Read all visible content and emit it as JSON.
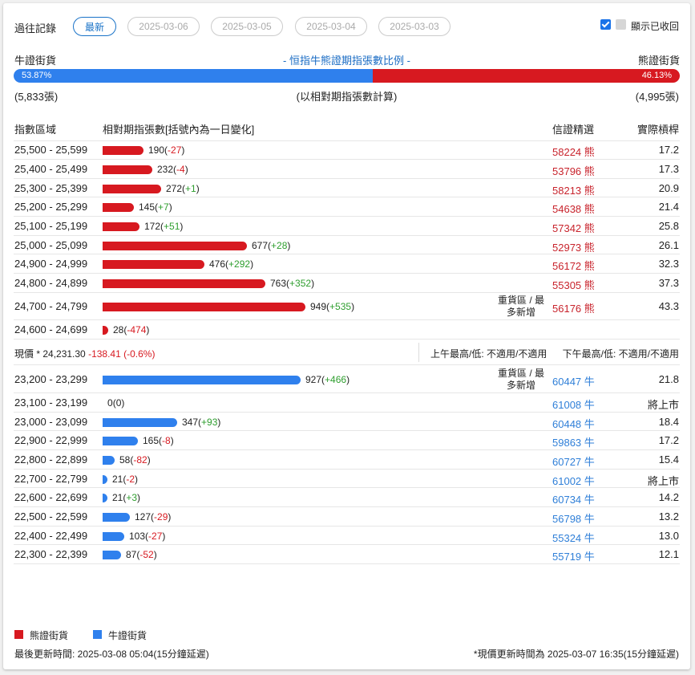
{
  "history": {
    "label": "過往記錄",
    "tabs": [
      "最新",
      "2025-03-06",
      "2025-03-05",
      "2025-03-04",
      "2025-03-03"
    ],
    "active_tab": 0,
    "toggle_label": "顯示已收回"
  },
  "ratio": {
    "bull_label": "牛證街貨",
    "bear_label": "熊證街貨",
    "title": "- 恒指牛熊證期指張數比例 -",
    "bull_pct": "53.87%",
    "bear_pct": "46.13%",
    "bull_fraction": 0.5387,
    "bull_count": "(5,833張)",
    "bear_count": "(4,995張)",
    "note": "(以相對期指張數計算)"
  },
  "table": {
    "headers": {
      "range": "指數區域",
      "contracts": "相對期指張數[括號內為一日變化]",
      "code": "信證精選",
      "leverage": "實際槓桿"
    },
    "colors": {
      "bear": "#d71920",
      "bull": "#2f80ed"
    },
    "bear_rows": [
      {
        "range": "25,500 - 25,599",
        "value": 190,
        "value_text": "190",
        "change": "-27",
        "code": "58224 熊",
        "leverage": "17.2",
        "note": ""
      },
      {
        "range": "25,400 - 25,499",
        "value": 232,
        "value_text": "232",
        "change": "-4",
        "code": "53796 熊",
        "leverage": "17.3",
        "note": ""
      },
      {
        "range": "25,300 - 25,399",
        "value": 272,
        "value_text": "272",
        "change": "+1",
        "code": "58213 熊",
        "leverage": "20.9",
        "note": ""
      },
      {
        "range": "25,200 - 25,299",
        "value": 145,
        "value_text": "145",
        "change": "+7",
        "code": "54638 熊",
        "leverage": "21.4",
        "note": ""
      },
      {
        "range": "25,100 - 25,199",
        "value": 172,
        "value_text": "172",
        "change": "+51",
        "code": "57342 熊",
        "leverage": "25.8",
        "note": ""
      },
      {
        "range": "25,000 - 25,099",
        "value": 677,
        "value_text": "677",
        "change": "+28",
        "code": "52973 熊",
        "leverage": "26.1",
        "note": ""
      },
      {
        "range": "24,900 - 24,999",
        "value": 476,
        "value_text": "476",
        "change": "+292",
        "code": "56172 熊",
        "leverage": "32.3",
        "note": ""
      },
      {
        "range": "24,800 - 24,899",
        "value": 763,
        "value_text": "763",
        "change": "+352",
        "code": "55305 熊",
        "leverage": "37.3",
        "note": ""
      },
      {
        "range": "24,700 - 24,799",
        "value": 949,
        "value_text": "949",
        "change": "+535",
        "code": "56176 熊",
        "leverage": "43.3",
        "note": "重貨區 / 最多新增"
      },
      {
        "range": "24,600 - 24,699",
        "value": 28,
        "value_text": "28",
        "change": "-474",
        "code": "",
        "leverage": "",
        "note": ""
      }
    ],
    "spot": {
      "label": "現價 *",
      "price": "24,231.30",
      "change": "-138.41 (-0.6%)",
      "am": "上午最高/低: 不適用/不適用",
      "pm": "下午最高/低: 不適用/不適用"
    },
    "bull_rows": [
      {
        "range": "23,200 - 23,299",
        "value": 927,
        "value_text": "927",
        "change": "+466",
        "code": "60447 牛",
        "leverage": "21.8",
        "note": "重貨區 / 最多新增"
      },
      {
        "range": "23,100 - 23,199",
        "value": 0,
        "value_text": "0",
        "change": "0",
        "code": "61008 牛",
        "leverage": "將上市",
        "note": ""
      },
      {
        "range": "23,000 - 23,099",
        "value": 347,
        "value_text": "347",
        "change": "+93",
        "code": "60448 牛",
        "leverage": "18.4",
        "note": ""
      },
      {
        "range": "22,900 - 22,999",
        "value": 165,
        "value_text": "165",
        "change": "-8",
        "code": "59863 牛",
        "leverage": "17.2",
        "note": ""
      },
      {
        "range": "22,800 - 22,899",
        "value": 58,
        "value_text": "58",
        "change": "-82",
        "code": "60727 牛",
        "leverage": "15.4",
        "note": ""
      },
      {
        "range": "22,700 - 22,799",
        "value": 21,
        "value_text": "21",
        "change": "-2",
        "code": "61002 牛",
        "leverage": "將上市",
        "note": ""
      },
      {
        "range": "22,600 - 22,699",
        "value": 21,
        "value_text": "21",
        "change": "+3",
        "code": "60734 牛",
        "leverage": "14.2",
        "note": ""
      },
      {
        "range": "22,500 - 22,599",
        "value": 127,
        "value_text": "127",
        "change": "-29",
        "code": "56798 牛",
        "leverage": "13.2",
        "note": ""
      },
      {
        "range": "22,400 - 22,499",
        "value": 103,
        "value_text": "103",
        "change": "-27",
        "code": "55324 牛",
        "leverage": "13.0",
        "note": ""
      },
      {
        "range": "22,300 - 22,399",
        "value": 87,
        "value_text": "87",
        "change": "-52",
        "code": "55719 牛",
        "leverage": "12.1",
        "note": ""
      }
    ]
  },
  "legend": {
    "bear": "熊證街貨",
    "bull": "牛證街貨"
  },
  "footer": {
    "updated": "最後更新時間: 2025-03-08 05:04(15分鐘延遲)",
    "spot_updated": "*現價更新時間為 2025-03-07 16:35(15分鐘延遲)"
  }
}
